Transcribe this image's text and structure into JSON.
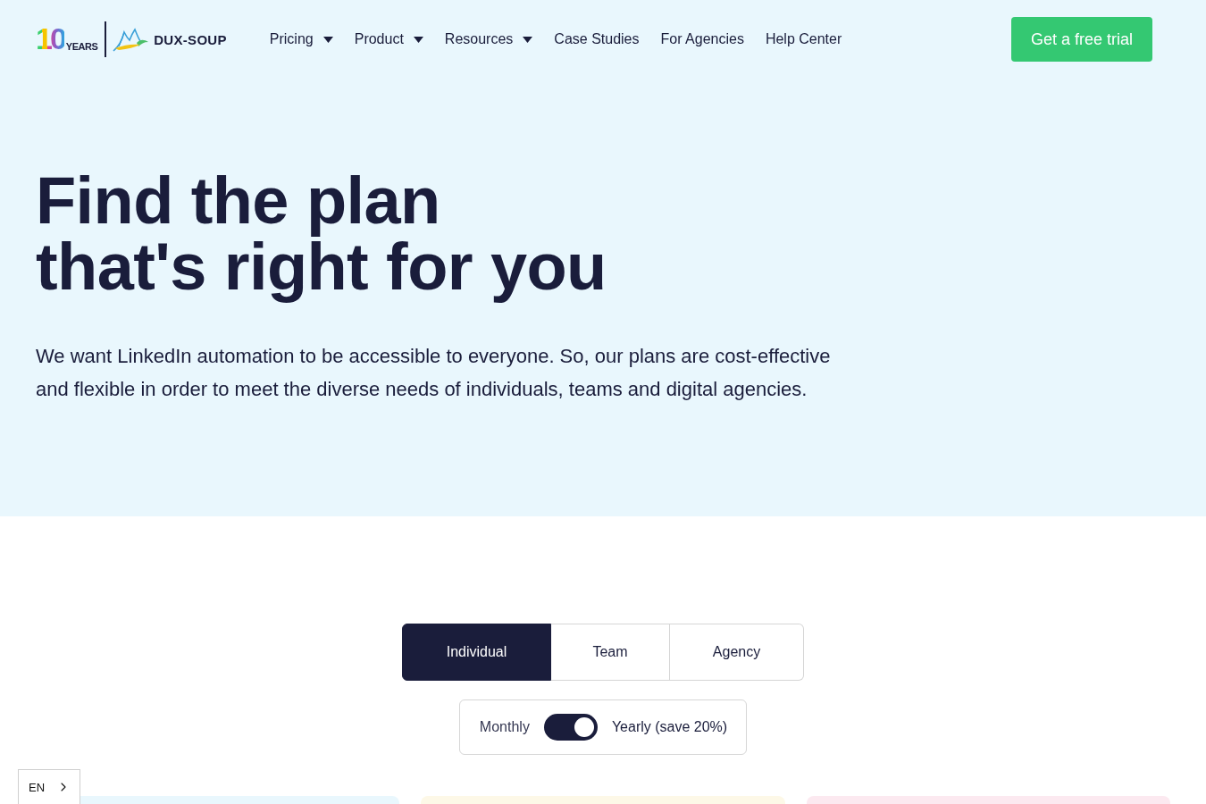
{
  "header": {
    "logo": {
      "anniversary_number": "10",
      "anniversary_label": "YEARS",
      "brand": "DUX-SOUP"
    },
    "nav": [
      {
        "label": "Pricing",
        "has_dropdown": true
      },
      {
        "label": "Product",
        "has_dropdown": true
      },
      {
        "label": "Resources",
        "has_dropdown": true
      },
      {
        "label": "Case Studies",
        "has_dropdown": false
      },
      {
        "label": "For Agencies",
        "has_dropdown": false
      },
      {
        "label": "Help Center",
        "has_dropdown": false
      }
    ],
    "cta": "Get a free trial"
  },
  "hero": {
    "title_lines": [
      "Find the plan",
      "that's right for you"
    ],
    "description": "We want LinkedIn automation to be accessible to everyone. So, our plans are cost-effective and flexible in order to meet the diverse needs of individuals, teams and digital agencies."
  },
  "plan_tabs": [
    {
      "label": "Individual",
      "selected": true
    },
    {
      "label": "Team",
      "selected": false
    },
    {
      "label": "Agency",
      "selected": false
    }
  ],
  "billing": {
    "monthly_label": "Monthly",
    "yearly_label": "Yearly (save 20%)",
    "yearly_selected": true
  },
  "language_switcher": {
    "label": "EN"
  }
}
